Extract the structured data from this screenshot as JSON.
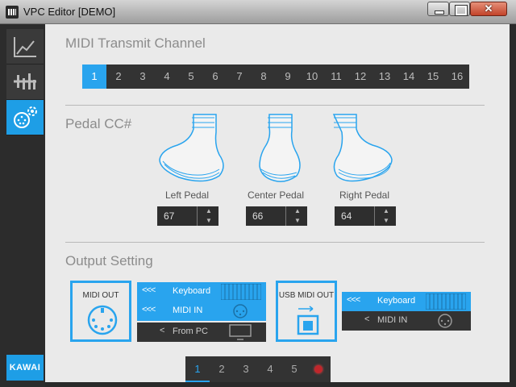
{
  "window": {
    "title": "VPC Editor [DEMO]",
    "close_glyph": "✕"
  },
  "sidebar": {
    "items": [
      {
        "icon": "velocity-curve-icon",
        "active": false
      },
      {
        "icon": "touch-settings-icon",
        "active": false
      },
      {
        "icon": "midi-settings-icon",
        "active": true
      }
    ],
    "brand": "KAWAI"
  },
  "midi_channel": {
    "title": "MIDI Transmit Channel",
    "channels": [
      "1",
      "2",
      "3",
      "4",
      "5",
      "6",
      "7",
      "8",
      "9",
      "10",
      "11",
      "12",
      "13",
      "14",
      "15",
      "16"
    ],
    "selected": "1"
  },
  "pedal_cc": {
    "title": "Pedal CC#",
    "pedals": [
      {
        "label": "Left Pedal",
        "value": "67"
      },
      {
        "label": "Center Pedal",
        "value": "66"
      },
      {
        "label": "Right Pedal",
        "value": "64"
      }
    ]
  },
  "output": {
    "title": "Output Setting",
    "midi_out": {
      "label": "MIDI OUT",
      "routes": [
        {
          "arrows": "<<<",
          "label": "Keyboard",
          "on": true
        },
        {
          "arrows": "<<<",
          "label": "MIDI IN",
          "on": true
        },
        {
          "arrows": "<",
          "label": "From PC",
          "on": false
        }
      ]
    },
    "usb_midi_out": {
      "label": "USB MIDI OUT",
      "routes": [
        {
          "arrows": "<<<",
          "label": "Keyboard",
          "on": true
        },
        {
          "arrows": "<",
          "label": "MIDI IN",
          "on": false
        }
      ]
    }
  },
  "pages": {
    "items": [
      "1",
      "2",
      "3",
      "4",
      "5"
    ],
    "selected": "1"
  },
  "colors": {
    "accent": "#29a4ee",
    "dark": "#333333",
    "background": "#eaeaea",
    "record": "#c0262b"
  }
}
